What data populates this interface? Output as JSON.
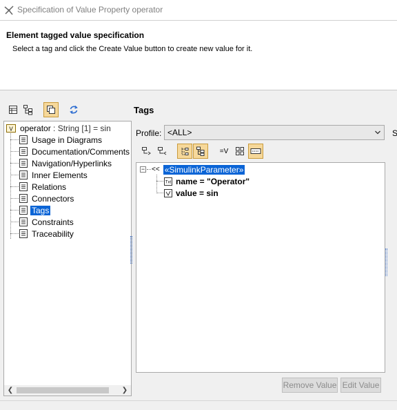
{
  "window": {
    "title": "Specification of Value Property operator"
  },
  "header": {
    "title": "Element tagged value specification",
    "description": "Select a tag and click the Create Value button to create new value for it."
  },
  "left_toolbar": {
    "buttons": [
      "table-view-icon",
      "tree-view-icon",
      "copy-icon",
      "refresh-icon"
    ],
    "active": "copy-icon"
  },
  "tree": {
    "root": {
      "name": "operator",
      "type": " : String [1] = sin"
    },
    "items": [
      {
        "label": "Usage in Diagrams"
      },
      {
        "label": "Documentation/Comments"
      },
      {
        "label": "Navigation/Hyperlinks"
      },
      {
        "label": "Inner Elements"
      },
      {
        "label": "Relations"
      },
      {
        "label": "Connectors"
      },
      {
        "label": "Tags"
      },
      {
        "label": "Constraints"
      },
      {
        "label": "Traceability"
      }
    ],
    "selected": "Tags"
  },
  "tags_panel": {
    "title": "Tags",
    "profile_label": "Profile:",
    "profile_value": "<ALL>",
    "cut_label": "S",
    "stereotype": "«SimulinkParameter»",
    "stereotype_symbol": "<<",
    "tag_values": [
      {
        "label": "name = \"Operator\"",
        "icon": "text-tag-icon"
      },
      {
        "label": "value = sin",
        "icon": "value-tag-icon"
      }
    ],
    "filter_label": "=V"
  },
  "buttons": {
    "remove_value": "Remove Value",
    "edit_value": "Edit Value"
  },
  "colors": {
    "selection": "#0a64d6",
    "active_button": "#f6d89a"
  }
}
